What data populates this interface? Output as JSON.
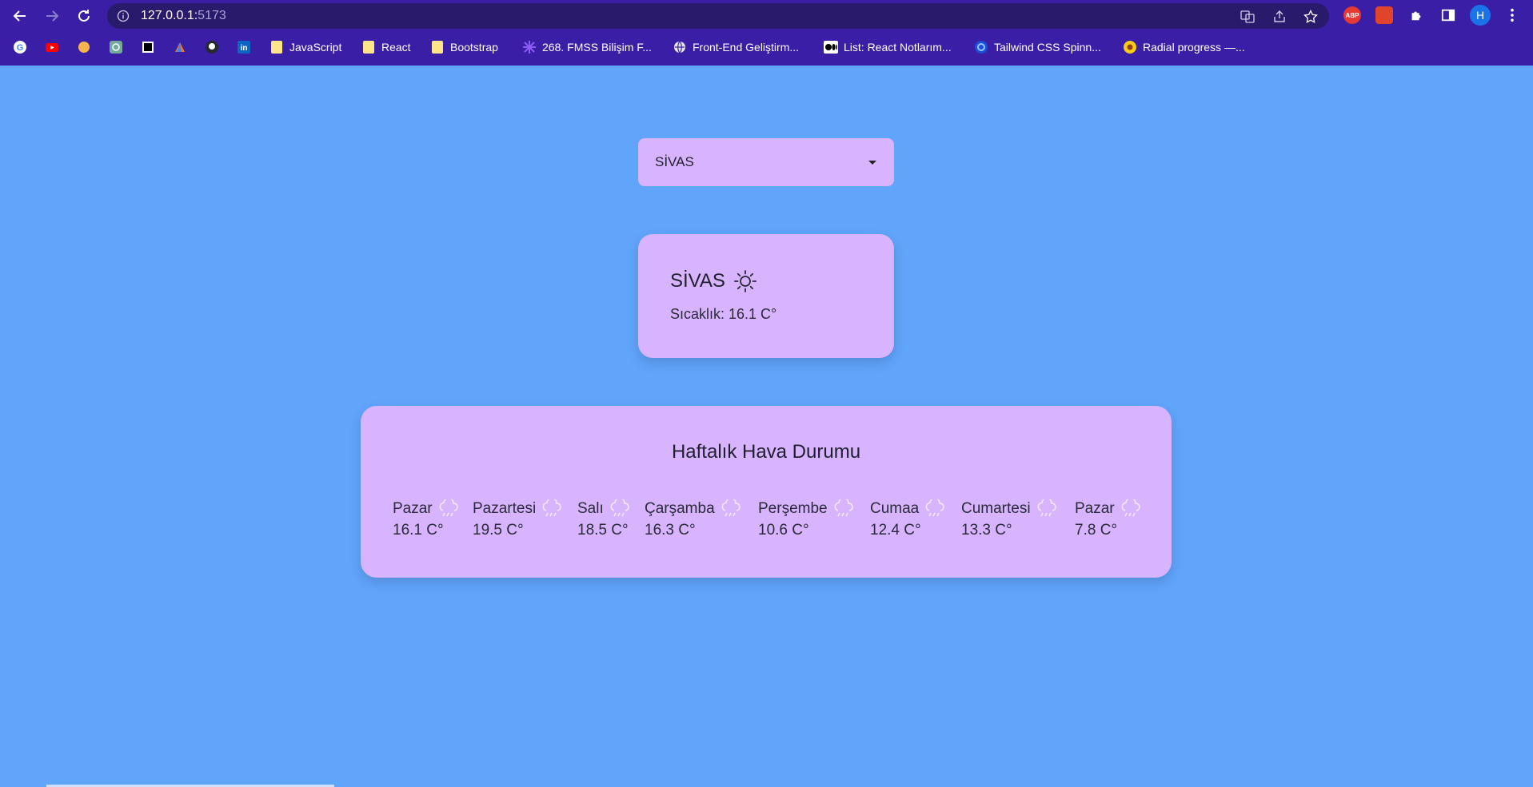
{
  "browser": {
    "url_host": "127.0.0.1:",
    "url_port": "5173",
    "profile_initial": "H",
    "abp_label": "ABP",
    "bookmarks": [
      {
        "label": "JavaScript"
      },
      {
        "label": "React"
      },
      {
        "label": "Bootstrap"
      },
      {
        "label": "268. FMSS Bilişim F..."
      },
      {
        "label": "Front-End Geliştirm..."
      },
      {
        "label": "List: React Notlarım..."
      },
      {
        "label": "Tailwind CSS Spinn..."
      },
      {
        "label": "Radial progress —..."
      }
    ]
  },
  "city_select": {
    "value": "SİVAS"
  },
  "current": {
    "city": "SİVAS",
    "icon": "sun-icon",
    "temperature_label": "Sıcaklık: 16.1 C°"
  },
  "weekly": {
    "title": "Haftalık Hava Durumu",
    "days": [
      {
        "name": "Pazar",
        "temp": "16.1 C°",
        "icon": "rain-cloud-icon"
      },
      {
        "name": "Pazartesi",
        "temp": "19.5 C°",
        "icon": "rain-cloud-icon"
      },
      {
        "name": "Salı",
        "temp": "18.5 C°",
        "icon": "rain-cloud-icon"
      },
      {
        "name": "Çarşamba",
        "temp": "16.3 C°",
        "icon": "rain-cloud-icon"
      },
      {
        "name": "Perşembe",
        "temp": "10.6 C°",
        "icon": "rain-cloud-icon"
      },
      {
        "name": "Cumaa",
        "temp": "12.4 C°",
        "icon": "rain-cloud-icon"
      },
      {
        "name": "Cumartesi",
        "temp": "13.3 C°",
        "icon": "rain-cloud-icon"
      },
      {
        "name": "Pazar",
        "temp": "7.8 C°",
        "icon": "rain-cloud-icon"
      }
    ]
  },
  "colors": {
    "page_background": "#60a5fa",
    "card_background": "#d8b4fe",
    "browser_chrome": "#3a1fa6"
  }
}
